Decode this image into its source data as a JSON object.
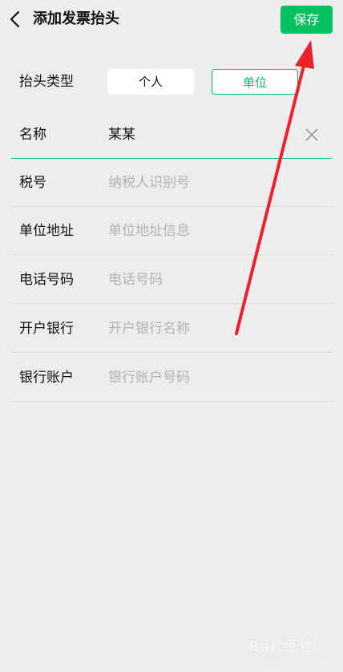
{
  "header": {
    "title": "添加发票抬头",
    "save_label": "保存"
  },
  "title_type": {
    "label": "抬头类型",
    "options": [
      "个人",
      "单位"
    ],
    "selected": "单位"
  },
  "fields": [
    {
      "label": "名称",
      "value": "某某",
      "placeholder": ""
    },
    {
      "label": "税号",
      "value": "",
      "placeholder": "纳税人识别号"
    },
    {
      "label": "单位地址",
      "value": "",
      "placeholder": "单位地址信息"
    },
    {
      "label": "电话号码",
      "value": "",
      "placeholder": "电话号码"
    },
    {
      "label": "开户银行",
      "value": "",
      "placeholder": "开户银行名称"
    },
    {
      "label": "银行账户",
      "value": "",
      "placeholder": "银行账户号码"
    }
  ],
  "colors": {
    "accent": "#07c160",
    "background": "#ededed",
    "annotation_arrow": "#e8232e"
  },
  "watermark": {
    "text": "Bai 经验",
    "subtext": "jingyan.baidu.com"
  }
}
